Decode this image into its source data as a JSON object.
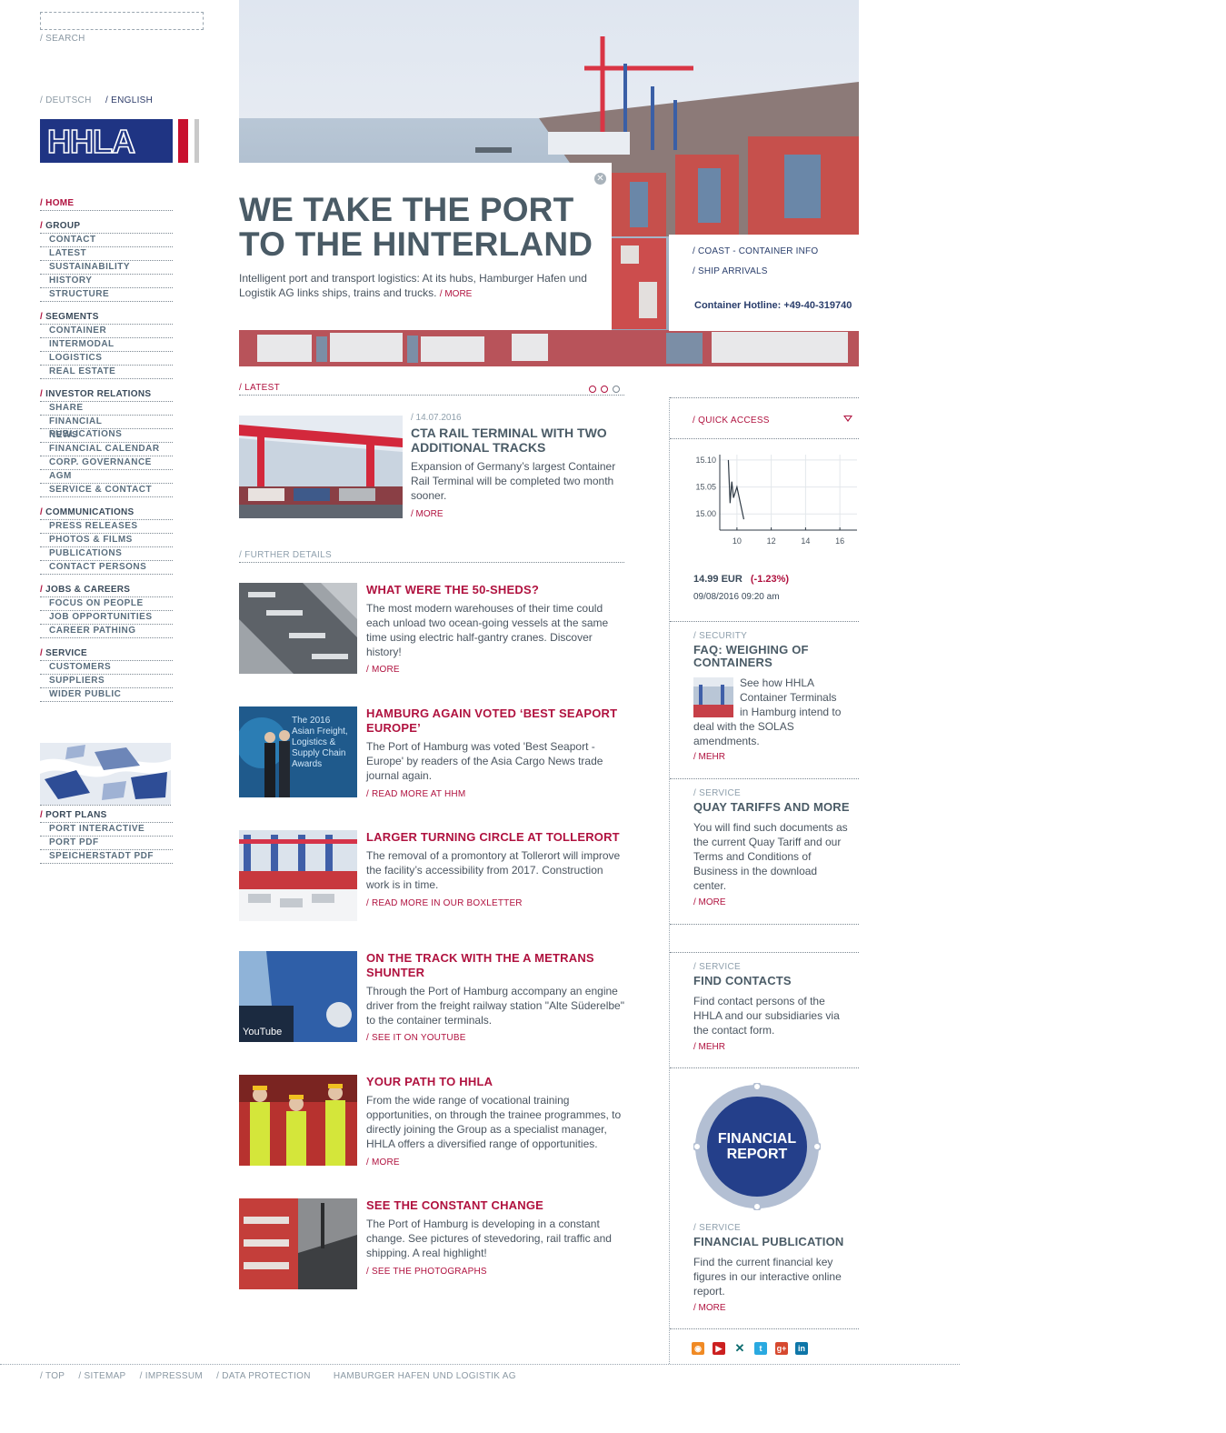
{
  "search": {
    "label": "/ SEARCH",
    "value": ""
  },
  "languages": {
    "deutsch": "/ DEUTSCH",
    "english": "/ ENGLISH"
  },
  "logo": {
    "text": "HHLA"
  },
  "nav": [
    {
      "head": "HOME",
      "active": true,
      "items": []
    },
    {
      "head": "GROUP",
      "items": [
        "CONTACT",
        "LATEST",
        "SUSTAINABILITY",
        "HISTORY",
        "STRUCTURE"
      ]
    },
    {
      "head": "SEGMENTS",
      "items": [
        "CONTAINER",
        "INTERMODAL",
        "LOGISTICS",
        "REAL ESTATE"
      ]
    },
    {
      "head": "INVESTOR RELATIONS",
      "items": [
        "SHARE",
        "FINANCIAL PUBLICATIONS",
        "NEWS",
        "FINANCIAL CALENDAR",
        "CORP. GOVERNANCE",
        "AGM",
        "SERVICE & CONTACT"
      ]
    },
    {
      "head": "COMMUNICATIONS",
      "items": [
        "PRESS RELEASES",
        "PHOTOS & FILMS",
        "PUBLICATIONS",
        "CONTACT PERSONS"
      ]
    },
    {
      "head": "JOBS & CAREERS",
      "items": [
        "FOCUS ON PEOPLE",
        "JOB OPPORTUNITIES",
        "CAREER PATHING"
      ]
    },
    {
      "head": "SERVICE",
      "items": [
        "CUSTOMERS",
        "SUPPLIERS",
        "WIDER PUBLIC"
      ]
    }
  ],
  "port_nav": {
    "head": "PORT PLANS",
    "items": [
      "PORT INTERACTIVE",
      "PORT PDF",
      "SPEICHERSTADT PDF"
    ]
  },
  "hero": {
    "title_line1": "WE TAKE THE PORT",
    "title_line2": "TO THE HINTERLAND",
    "text": "Intelligent port and transport logistics: At its hubs, Hamburger Hafen und Logistik AG links ships, trains and trucks.",
    "more": "/ MORE",
    "links": [
      "/ COAST - CONTAINER INFO",
      "/ SHIP ARRIVALS"
    ],
    "hotline": "Container Hotline: +49-40-319740"
  },
  "latest": {
    "label": "/ LATEST",
    "date": "/ 14.07.2016",
    "title": "CTA RAIL TERMINAL WITH TWO ADDITIONAL TRACKS",
    "text": "Expansion of Germany’s largest Container Rail Terminal will be completed two month sooner.",
    "more": "/ MORE"
  },
  "further": {
    "label": "/ FURTHER DETAILS",
    "items": [
      {
        "title": "WHAT WERE THE 50-SHEDS?",
        "text": "The most modern warehouses of their time could each unload two ocean-going vessels at the same time using electric half-gantry cranes. Discover history!",
        "more": "/ MORE"
      },
      {
        "title": "HAMBURG AGAIN VOTED ‘BEST SEAPORT EUROPE’",
        "text": "The Port of Hamburg was voted 'Best Seaport - Europe' by readers of the Asia Cargo News trade journal again.",
        "more": "/ READ MORE AT HHM",
        "img_text": "The 2016 Asian Freight, Logistics & Supply Chain Awards"
      },
      {
        "title": "LARGER TURNING CIRCLE AT TOLLERORT",
        "text": "The removal of a promontory at Tollerort will improve the facility’s accessibility from 2017. Construction work is in time.",
        "more": "/ READ MORE IN OUR BOXLETTER"
      },
      {
        "title": "ON THE TRACK WITH THE A METRANS SHUNTER",
        "text": "Through the Port of Hamburg accompany an engine driver from the freight railway station \"Alte Süderelbe\" to the container terminals.",
        "more": "/ SEE IT ON YOUTUBE",
        "img_text": "YouTube"
      },
      {
        "title": "YOUR PATH TO HHLA",
        "text": "From the wide range of vocational training opportunities, on through the trainee programmes, to directly joining the Group as a specialist manager, HHLA offers a diversified range of opportunities.",
        "more": "/ MORE"
      },
      {
        "title": "SEE THE CONSTANT CHANGE",
        "text": "The Port of Hamburg is developing in a constant change. See pictures of stevedoring, rail traffic and shipping. A real highlight!",
        "more": "/ SEE THE PHOTOGRAPHS"
      }
    ]
  },
  "quick_access": {
    "label": "/ QUICK ACCESS"
  },
  "share": {
    "price": "14.99 EUR",
    "change": "(-1.23%)",
    "date": "09/08/2016 09:20 am"
  },
  "chart_data": {
    "type": "line",
    "x": [
      9.5,
      9.6,
      9.7,
      9.8,
      9.9,
      10.0,
      10.2,
      10.4
    ],
    "y": [
      15.1,
      15.02,
      15.06,
      15.03,
      15.04,
      15.05,
      15.02,
      14.99
    ],
    "yticks": [
      "15.10",
      "15.05",
      "15.00"
    ],
    "xticks": [
      "10",
      "12",
      "14",
      "16"
    ],
    "xlim": [
      9,
      17
    ],
    "ylim": [
      14.97,
      15.11
    ],
    "grid": true
  },
  "sidebar": [
    {
      "cat": "/ SECURITY",
      "title": "FAQ: WEIGHING OF CONTAINERS",
      "text": "See how HHLA Container Terminals in Hamburg intend to deal with the SOLAS amendments.",
      "more": "/ MEHR"
    },
    {
      "cat": "/ SERVICE",
      "title": "QUAY TARIFFS AND MORE",
      "text": "You will find such documents as the current Quay Tariff and our Terms and Conditions of Business in the download center.",
      "more": "/ MORE"
    },
    {
      "cat": "/ SERVICE",
      "title": "FIND CONTACTS",
      "text": "Find contact persons of the HHLA and our subsidiaries via the contact form.",
      "more": "/ MEHR"
    },
    {
      "cat": "/ SERVICE",
      "title": "FINANCIAL PUBLICATION",
      "text": "Find the current financial key figures in our interactive online report.",
      "more": "/ MORE",
      "badge_line1": "FINANCIAL",
      "badge_line2": "REPORT"
    }
  ],
  "social": [
    {
      "icon": "rss-icon",
      "color": "#f08a24"
    },
    {
      "icon": "youtube-icon",
      "color": "#cc2020"
    },
    {
      "icon": "xing-icon",
      "color": "#0b6b6e"
    },
    {
      "icon": "twitter-icon",
      "color": "#2aa9e0"
    },
    {
      "icon": "googleplus-icon",
      "color": "#d6492f"
    },
    {
      "icon": "linkedin-icon",
      "color": "#0e76a8"
    }
  ],
  "footer": {
    "top": "/ TOP",
    "sitemap": "/ SITEMAP",
    "impressum": "/ IMPRESSUM",
    "privacy": "/ DATA PROTECTION",
    "company": "HAMBURGER HAFEN UND LOGISTIK AG"
  },
  "colors": {
    "brand_blue": "#1f3483",
    "accent_red": "#b0123f",
    "text_gray": "#4a5b66"
  }
}
